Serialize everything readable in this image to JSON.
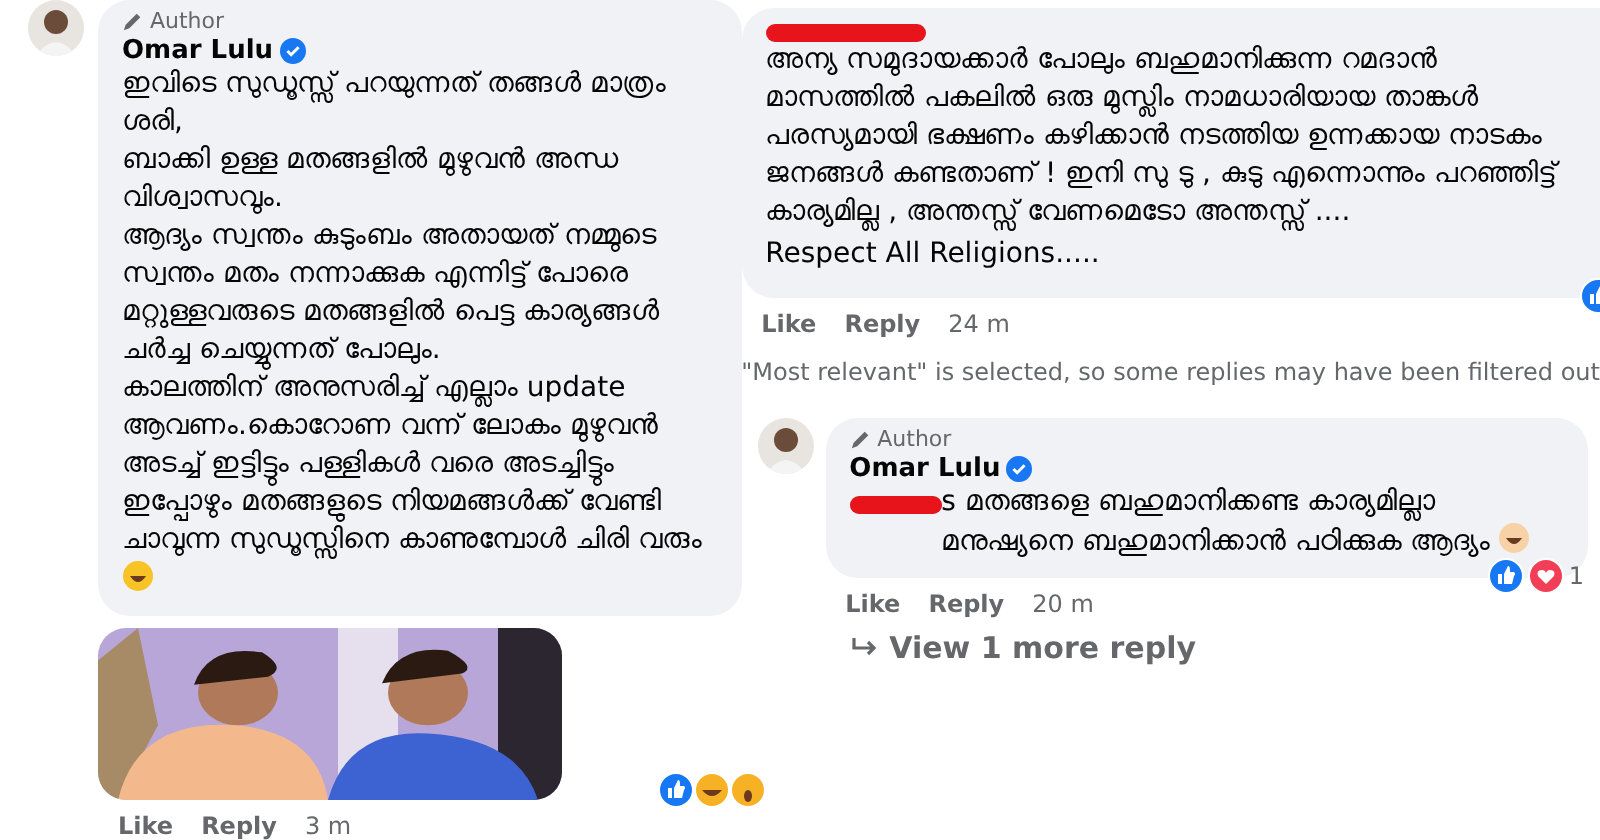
{
  "left_comment": {
    "badge": "Author",
    "author": "Omar Lulu",
    "verified": true,
    "paragraphs": [
      "ഇവിടെ സുഡൂസ്സ് പറയുന്നത് തങ്ങൾ മാത്രം ശരി,",
      "ബാക്കി ഉള്ള മതങ്ങളിൽ മുഴുവൻ അന്ധ വിശ്വാസവും.",
      "ആദ്യം സ്വന്തം കുടുംബം അതായത് നമ്മുടെ സ്വന്തം മതം നന്നാക്കുക എന്നിട്ട് പോരെ മറ്റുള്ളവരുടെ മതങ്ങളിൽ പെട്ട കാര്യങ്ങൾ ചർച്ച ചെയ്യുന്നത് പോലും.",
      "കാലത്തിന് അനുസരിച്ച് എല്ലാം update ആവണം.കൊറോണ വന്ന് ലോകം മുഴുവൻ അടച്ച് ഇട്ടിട്ടും പള്ളികൾ വരെ അടച്ചിട്ടും ഇപ്പോഴും മതങ്ങളുടെ നിയമങ്ങൾക്ക് വേണ്ടി ചാവുന്ന സുഡൂസ്സിനെ കാണുമ്പോൾ ചിരി വരും"
    ],
    "actions": [
      "Like",
      "Reply"
    ],
    "time": "3 m"
  },
  "right_comment": {
    "paragraphs": [
      "അന്യ സമുദായക്കാർ പോലും ബഹുമാനിക്കുന്ന റമദാൻ മാസത്തിൽ പകലിൽ ഒരു മുസ്ലിം നാമധാരിയായ താങ്കൾ പരസ്യമായി ഭക്ഷണം കഴിക്കാൻ നടത്തിയ ഉന്നക്കായ നാടകം ജനങ്ങൾ കണ്ടതാണ് ! ഇനി സു ടു , കുടു എന്നൊന്നും പറഞ്ഞിട്ട് കാര്യമില്ല , അന്തസ്സ് വേണമെടോ അന്തസ്സ് ....",
      "Respect All Religions....."
    ],
    "actions": [
      "Like",
      "Reply"
    ],
    "time": "24 m"
  },
  "filter_note": "\"Most relevant\" is selected, so some replies may have been filtered out",
  "reply": {
    "badge": "Author",
    "author": "Omar Lulu",
    "verified": true,
    "text": "s മതങ്ങളെ ബഹുമാനിക്കണ്ട കാര്യമില്ലാ മനുഷ്യനെ ബഹുമാനിക്കാൻ പഠിക്കുക ആദ്യം",
    "actions": [
      "Like",
      "Reply"
    ],
    "time": "20 m",
    "reaction_count": "1"
  },
  "more_replies": "View 1 more reply"
}
